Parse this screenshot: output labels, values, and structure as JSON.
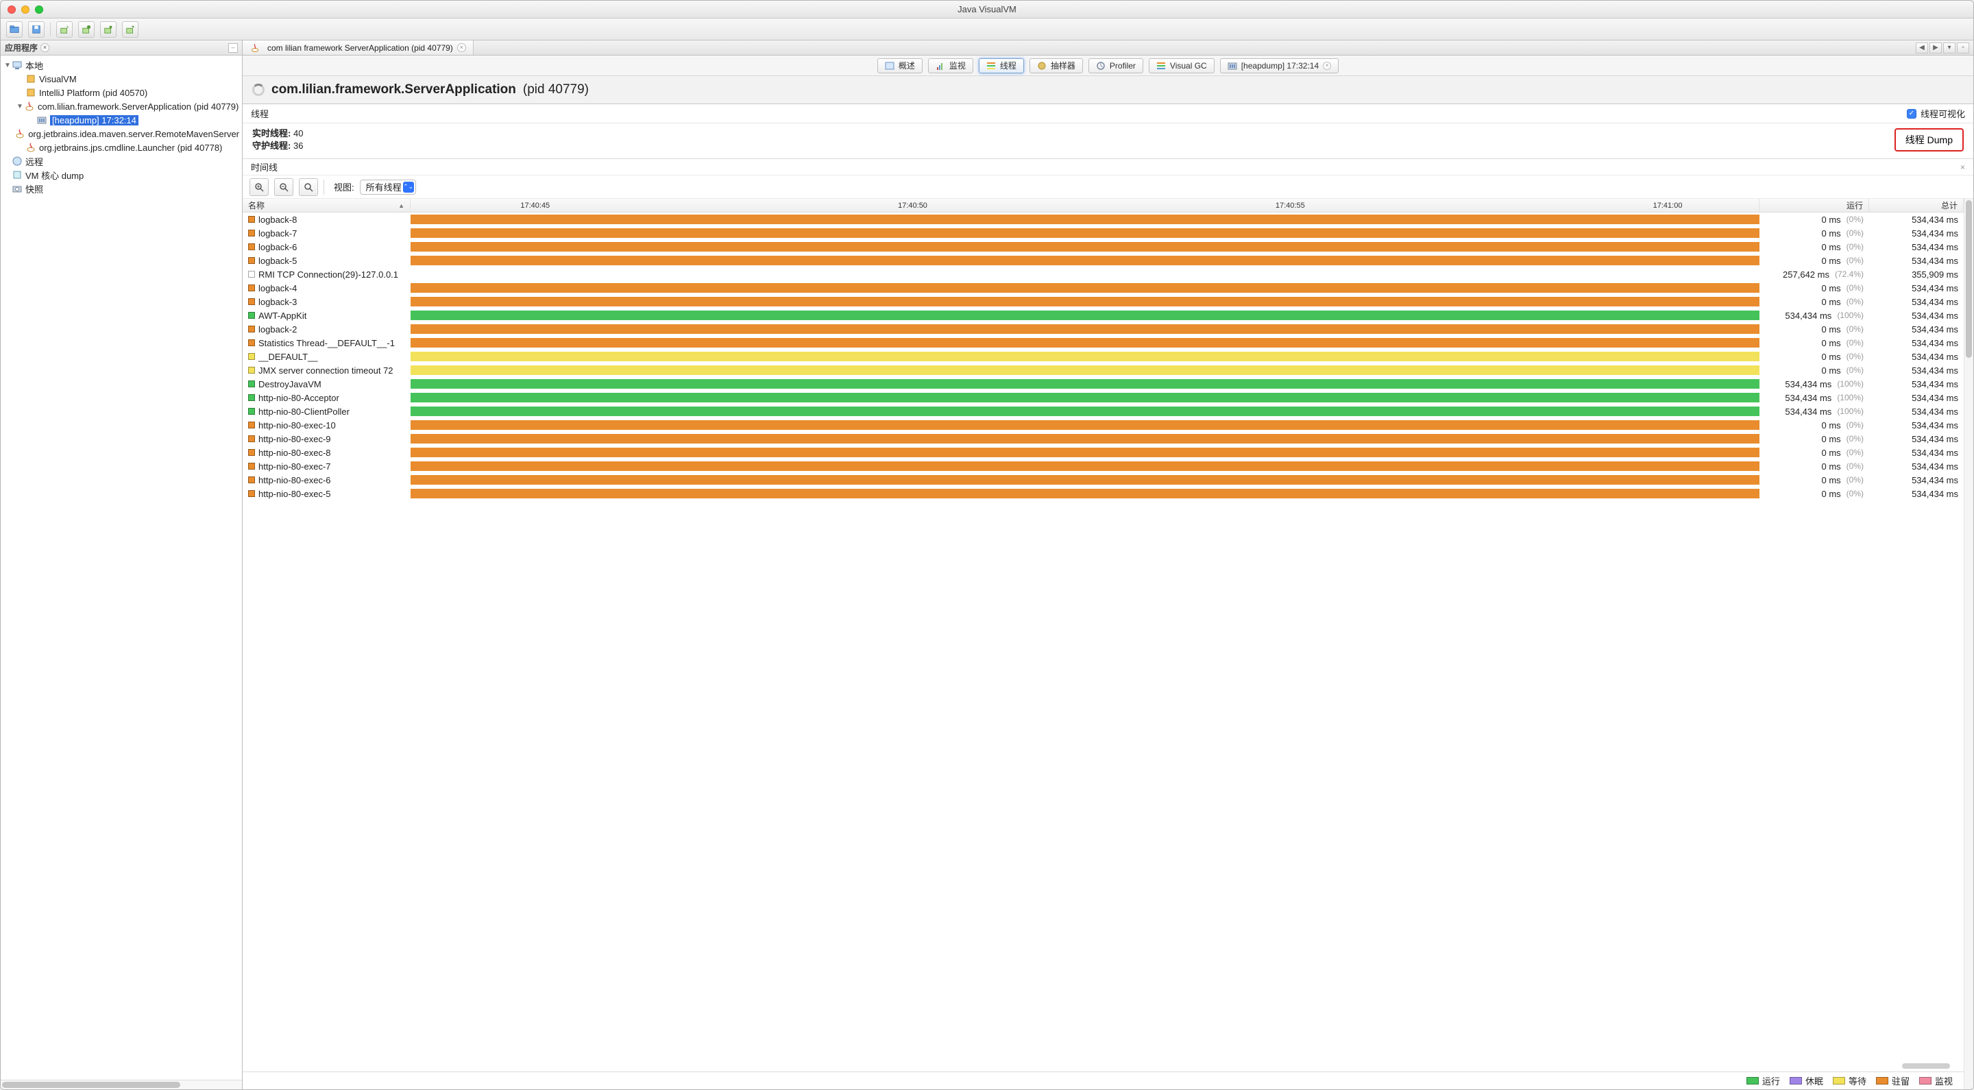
{
  "window_title": "Java VisualVM",
  "sidebar": {
    "title": "应用程序",
    "nodes": {
      "local": "本地",
      "visualvm": "VisualVM",
      "intellij": "IntelliJ Platform (pid 40570)",
      "serverapp": "com.lilian.framework.ServerApplication (pid 40779)",
      "heapdump": "[heapdump] 17:32:14",
      "maven": "org.jetbrains.idea.maven.server.RemoteMavenServer",
      "launcher": "org.jetbrains.jps.cmdline.Launcher (pid 40778)",
      "remote": "远程",
      "vmcore": "VM 核心 dump",
      "snapshot": "快照"
    }
  },
  "doc_tab": {
    "label": "com lilian framework ServerApplication (pid 40779)"
  },
  "section_tabs": {
    "overview": "概述",
    "monitor": "监视",
    "threads": "线程",
    "sampler": "抽样器",
    "profiler": "Profiler",
    "visualgc": "Visual GC",
    "heapdump": "[heapdump] 17:32:14"
  },
  "app_title": {
    "main": "com.lilian.framework.ServerApplication",
    "pid": "(pid 40779)"
  },
  "threads_panel": {
    "title": "线程",
    "visual_label": "线程可视化",
    "live_label": "实时线程:",
    "live_value": "40",
    "daemon_label": "守护线程:",
    "daemon_value": "36",
    "dump_button": "线程 Dump"
  },
  "timeline": {
    "title": "时间线",
    "view_label": "视图:",
    "view_value": "所有线程",
    "col_name": "名称",
    "col_run": "运行",
    "col_total": "总计",
    "ticks": [
      "17:40:45",
      "17:40:50",
      "17:40:55",
      "17:41:00"
    ]
  },
  "legend": {
    "run": "运行",
    "sleep": "休眠",
    "wait": "等待",
    "park": "驻留",
    "monitor": "监视"
  },
  "threads": [
    {
      "name": "logback-8",
      "state": "orange",
      "run": "0 ms",
      "pct": "(0%)",
      "total": "534,434 ms"
    },
    {
      "name": "logback-7",
      "state": "orange",
      "run": "0 ms",
      "pct": "(0%)",
      "total": "534,434 ms"
    },
    {
      "name": "logback-6",
      "state": "orange",
      "run": "0 ms",
      "pct": "(0%)",
      "total": "534,434 ms"
    },
    {
      "name": "logback-5",
      "state": "orange",
      "run": "0 ms",
      "pct": "(0%)",
      "total": "534,434 ms"
    },
    {
      "name": "RMI TCP Connection(29)-127.0.0.1",
      "state": "white",
      "run": "257,642 ms",
      "pct": "(72.4%)",
      "total": "355,909 ms"
    },
    {
      "name": "logback-4",
      "state": "orange",
      "run": "0 ms",
      "pct": "(0%)",
      "total": "534,434 ms"
    },
    {
      "name": "logback-3",
      "state": "orange",
      "run": "0 ms",
      "pct": "(0%)",
      "total": "534,434 ms"
    },
    {
      "name": "AWT-AppKit",
      "state": "green",
      "run": "534,434 ms",
      "pct": "(100%)",
      "total": "534,434 ms"
    },
    {
      "name": "logback-2",
      "state": "orange",
      "run": "0 ms",
      "pct": "(0%)",
      "total": "534,434 ms"
    },
    {
      "name": "Statistics Thread-__DEFAULT__-1",
      "state": "orange",
      "run": "0 ms",
      "pct": "(0%)",
      "total": "534,434 ms"
    },
    {
      "name": "__DEFAULT__",
      "state": "yellow",
      "run": "0 ms",
      "pct": "(0%)",
      "total": "534,434 ms"
    },
    {
      "name": "JMX server connection timeout 72",
      "state": "yellow",
      "run": "0 ms",
      "pct": "(0%)",
      "total": "534,434 ms"
    },
    {
      "name": "DestroyJavaVM",
      "state": "green",
      "run": "534,434 ms",
      "pct": "(100%)",
      "total": "534,434 ms"
    },
    {
      "name": "http-nio-80-Acceptor",
      "state": "green",
      "run": "534,434 ms",
      "pct": "(100%)",
      "total": "534,434 ms"
    },
    {
      "name": "http-nio-80-ClientPoller",
      "state": "green",
      "run": "534,434 ms",
      "pct": "(100%)",
      "total": "534,434 ms"
    },
    {
      "name": "http-nio-80-exec-10",
      "state": "orange",
      "run": "0 ms",
      "pct": "(0%)",
      "total": "534,434 ms"
    },
    {
      "name": "http-nio-80-exec-9",
      "state": "orange",
      "run": "0 ms",
      "pct": "(0%)",
      "total": "534,434 ms"
    },
    {
      "name": "http-nio-80-exec-8",
      "state": "orange",
      "run": "0 ms",
      "pct": "(0%)",
      "total": "534,434 ms"
    },
    {
      "name": "http-nio-80-exec-7",
      "state": "orange",
      "run": "0 ms",
      "pct": "(0%)",
      "total": "534,434 ms"
    },
    {
      "name": "http-nio-80-exec-6",
      "state": "orange",
      "run": "0 ms",
      "pct": "(0%)",
      "total": "534,434 ms"
    },
    {
      "name": "http-nio-80-exec-5",
      "state": "orange",
      "run": "0 ms",
      "pct": "(0%)",
      "total": "534,434 ms"
    }
  ]
}
